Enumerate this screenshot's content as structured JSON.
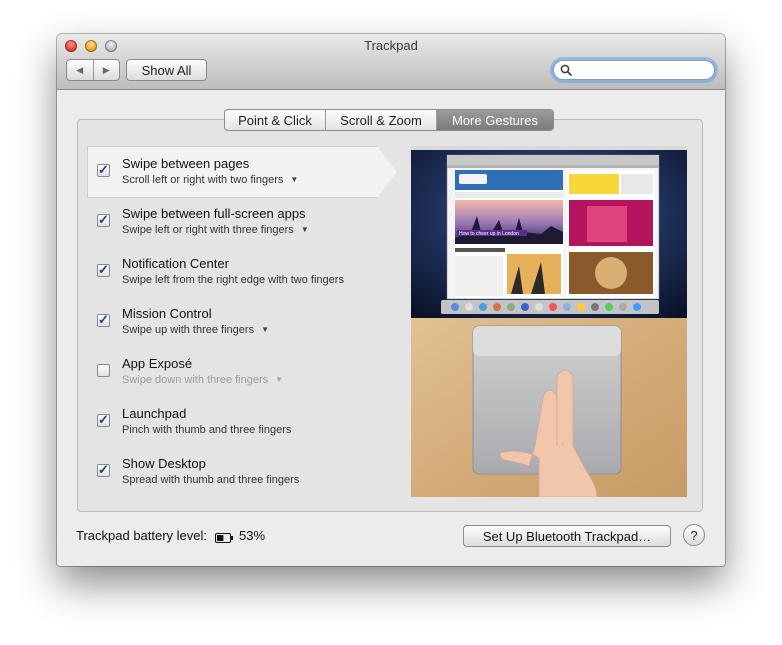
{
  "window": {
    "title": "Trackpad",
    "toolbar": {
      "back_icon": "◀",
      "forward_icon": "▶",
      "show_all_label": "Show All",
      "search_value": "",
      "search_placeholder": ""
    }
  },
  "tabs": [
    {
      "label": "Point & Click",
      "active": false
    },
    {
      "label": "Scroll & Zoom",
      "active": false
    },
    {
      "label": "More Gestures",
      "active": true
    }
  ],
  "gestures": [
    {
      "title": "Swipe between pages",
      "subtitle": "Scroll left or right with two fingers",
      "checked": true,
      "has_menu": true,
      "enabled": true,
      "selected": true
    },
    {
      "title": "Swipe between full-screen apps",
      "subtitle": "Swipe left or right with three fingers",
      "checked": true,
      "has_menu": true,
      "enabled": true,
      "selected": false
    },
    {
      "title": "Notification Center",
      "subtitle": "Swipe left from the right edge with two fingers",
      "checked": true,
      "has_menu": false,
      "enabled": true,
      "selected": false
    },
    {
      "title": "Mission Control",
      "subtitle": "Swipe up with three fingers",
      "checked": true,
      "has_menu": true,
      "enabled": true,
      "selected": false
    },
    {
      "title": "App Exposé",
      "subtitle": "Swipe down with three fingers",
      "checked": false,
      "has_menu": true,
      "enabled": false,
      "selected": false
    },
    {
      "title": "Launchpad",
      "subtitle": "Pinch with thumb and three fingers",
      "checked": true,
      "has_menu": false,
      "enabled": true,
      "selected": false
    },
    {
      "title": "Show Desktop",
      "subtitle": "Spread with thumb and three fingers",
      "checked": true,
      "has_menu": false,
      "enabled": true,
      "selected": false
    }
  ],
  "preview": {
    "article_headline": "How to cheer up in London"
  },
  "footer": {
    "battery_label": "Trackpad battery level:",
    "battery_value": "53%",
    "battery_fraction": 0.53,
    "bluetooth_button": "Set Up Bluetooth Trackpad…",
    "help_label": "?"
  },
  "colors": {
    "accent": "#1b3f8a",
    "active_tab": "#8a8a8a",
    "search_focus": "#60a0e8"
  }
}
